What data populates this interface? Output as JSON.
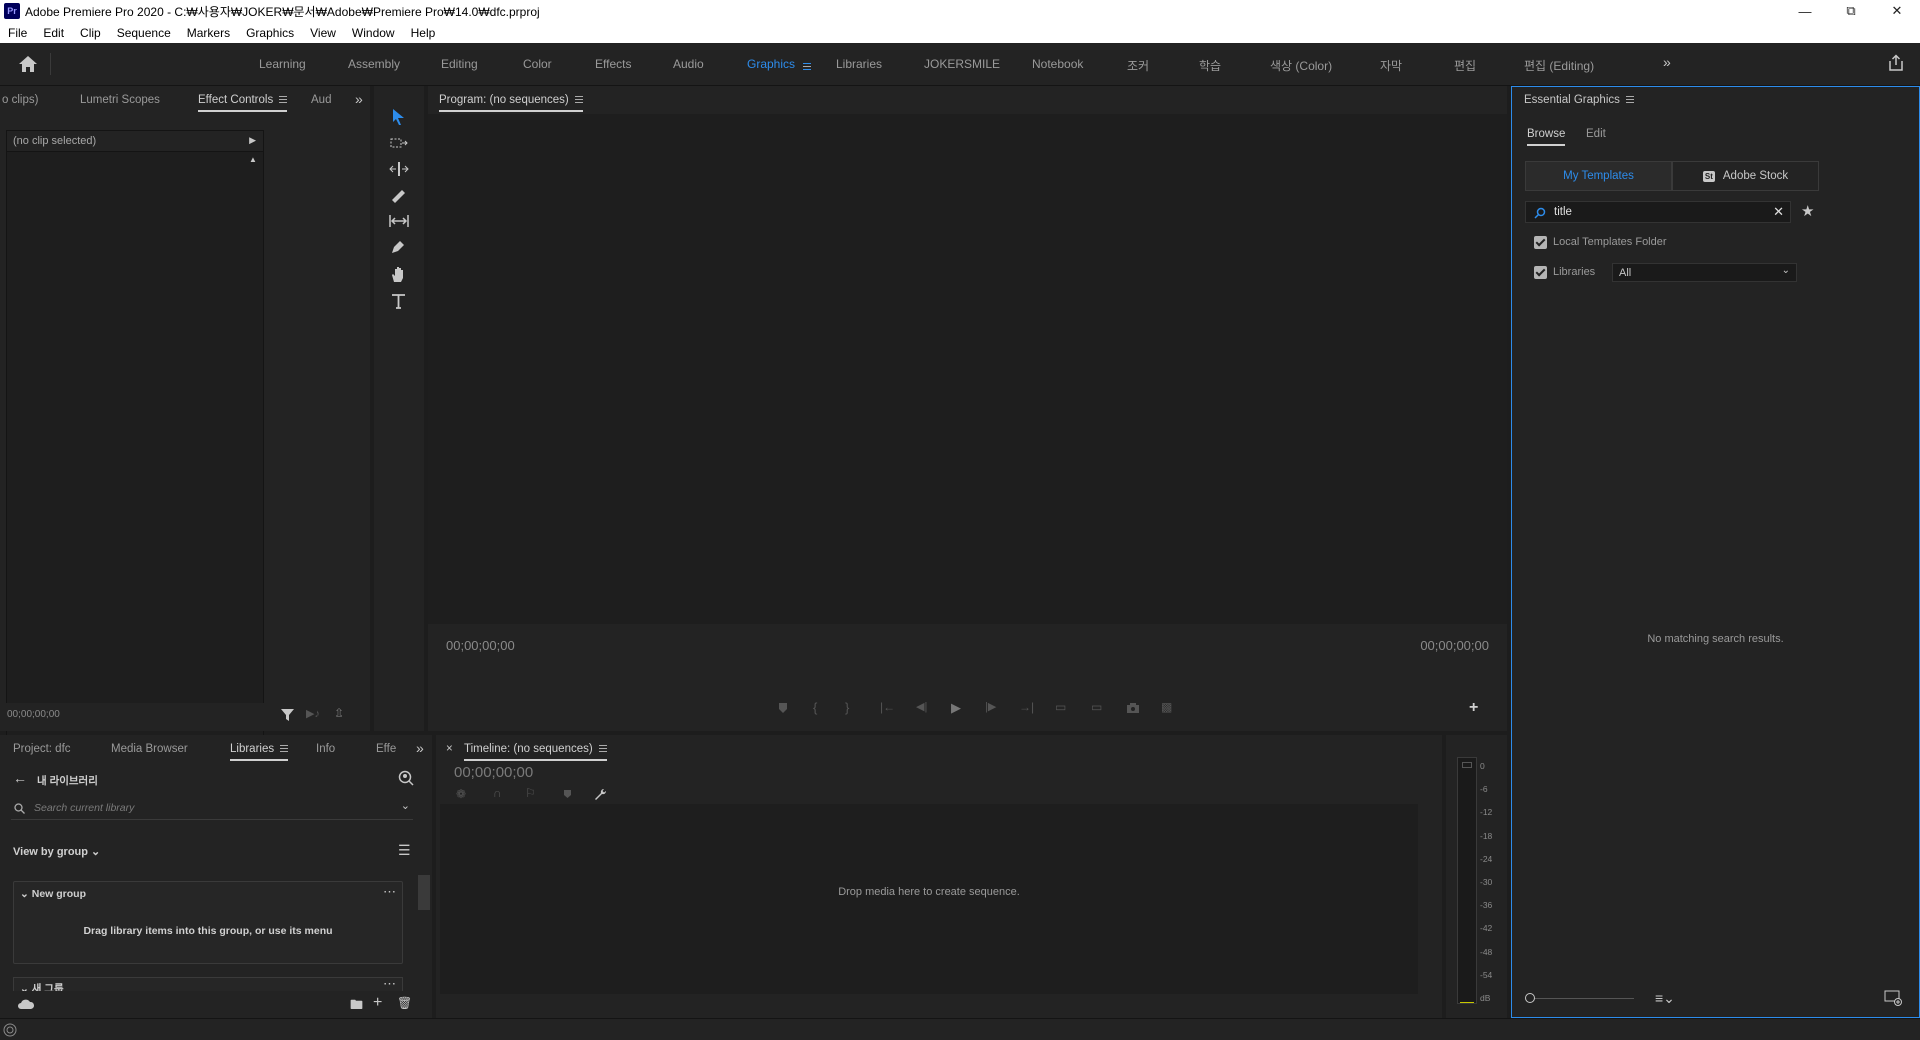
{
  "window": {
    "app_icon_label": "Pr",
    "title": "Adobe Premiere Pro 2020 - C:₩사용자₩JOKER₩문서₩Adobe₩Premiere Pro₩14.0₩dfc.prproj"
  },
  "menu": [
    "File",
    "Edit",
    "Clip",
    "Sequence",
    "Markers",
    "Graphics",
    "View",
    "Window",
    "Help"
  ],
  "workspaces": {
    "items": [
      "Learning",
      "Assembly",
      "Editing",
      "Color",
      "Effects",
      "Audio",
      "Graphics",
      "Libraries",
      "JOKERSMILE",
      "Notebook",
      "조커",
      "학습",
      "색상 (Color)",
      "자막",
      "편집",
      "편집 (Editing)"
    ],
    "active": "Graphics",
    "active_color": "#2d8ceb"
  },
  "source_panel": {
    "tabs": [
      "o clips)",
      "Lumetri Scopes",
      "Effect Controls",
      "Aud"
    ],
    "active_tab": "Effect Controls",
    "clip_selector": "(no clip selected)",
    "timecode": "00;00;00;00"
  },
  "tools": [
    "selection-tool",
    "track-select-tool",
    "ripple-edit-tool",
    "razor-tool",
    "slip-tool",
    "pen-tool",
    "hand-tool",
    "type-tool"
  ],
  "program_monitor": {
    "title": "Program: (no sequences)",
    "timecode_left": "00;00;00;00",
    "timecode_right": "00;00;00;00"
  },
  "essential_graphics": {
    "title": "Essential Graphics",
    "subtabs": [
      "Browse",
      "Edit"
    ],
    "active_subtab": "Browse",
    "source_tabs": [
      "My Templates",
      "Adobe Stock"
    ],
    "active_source": "My Templates",
    "stock_badge": "St",
    "search_value": "title",
    "local_templates_label": "Local Templates Folder",
    "libraries_label": "Libraries",
    "libraries_select": "All",
    "empty_message": "No matching search results."
  },
  "project_panel": {
    "tabs": [
      "Project: dfc",
      "Media Browser",
      "Libraries",
      "Info",
      "Effe"
    ],
    "active_tab": "Libraries",
    "library_name": "내 라이브러리",
    "search_placeholder": "Search current library",
    "view_by": "View by group",
    "group1_name": "New group",
    "group1_hint": "Drag library items into this group, or use its menu",
    "group2_name": "새 그룹"
  },
  "timeline": {
    "title": "Timeline: (no sequences)",
    "timecode": "00;00;00;00",
    "drop_hint": "Drop media here to create sequence."
  },
  "audio_meter": {
    "labels": [
      "0",
      "-6",
      "-12",
      "-18",
      "-24",
      "-30",
      "-36",
      "-42",
      "-48",
      "-54",
      "dB"
    ]
  }
}
